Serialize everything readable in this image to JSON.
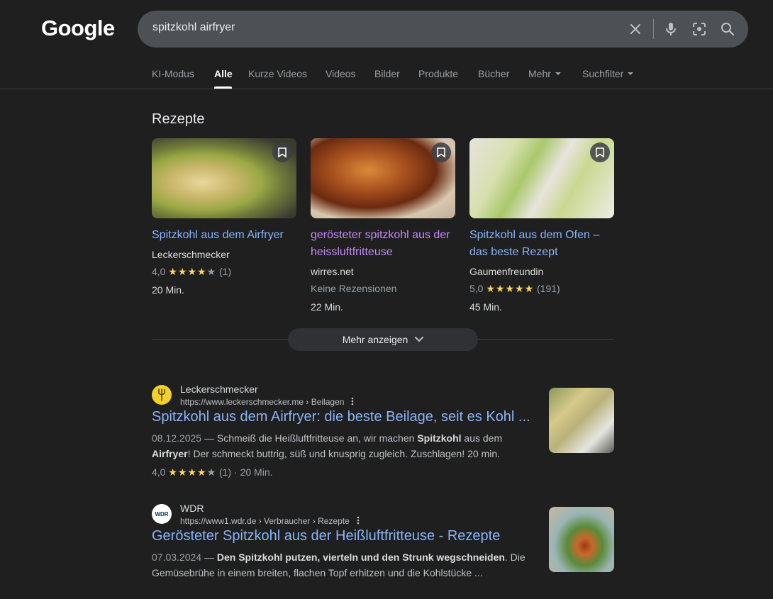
{
  "header": {
    "logo": "Google",
    "search_value": "spitzkohl airfryer"
  },
  "tabs": [
    {
      "label": "KI-Modus"
    },
    {
      "label": "Alle"
    },
    {
      "label": "Kurze Videos"
    },
    {
      "label": "Videos"
    },
    {
      "label": "Bilder"
    },
    {
      "label": "Produkte"
    },
    {
      "label": "Bücher"
    },
    {
      "label": "Mehr"
    },
    {
      "label": "Suchfilter"
    }
  ],
  "recipes": {
    "title": "Rezepte",
    "cards": [
      {
        "title": "Spitzkohl aus dem Airfryer",
        "source": "Leckerschmecker",
        "rating": "4,0",
        "stars": 4,
        "count": "(1)",
        "time": "20 Min."
      },
      {
        "title": "gerösteter spitzkohl aus der heissluftfritteuse",
        "source": "wirres.net",
        "no_reviews": "Keine Rezensionen",
        "time": "22 Min."
      },
      {
        "title": "Spitzkohl aus dem Ofen – das beste Rezept",
        "source": "Gaumenfreundin",
        "rating": "5,0",
        "stars": 5,
        "count": "(191)",
        "time": "45 Min."
      }
    ],
    "more_label": "Mehr anzeigen"
  },
  "results": [
    {
      "site": "Leckerschmecker",
      "url": "https://www.leckerschmecker.me › Beilagen",
      "title": "Spitzkohl aus dem Airfryer: die beste Beilage, seit es Kohl ...",
      "date": "08.12.2025",
      "snippet_parts": [
        "Schmeiß die Heißluftfritteuse an, wir machen ",
        "Spitzkohl",
        " aus dem ",
        "Airfryer",
        "! Der schmeckt buttrig, süß und knusprig zugleich. Zuschlagen! 20 min."
      ],
      "rating": "4,0",
      "count": "(1)",
      "time": "20 Min."
    },
    {
      "site": "WDR",
      "url": "https://www1.wdr.de › Verbraucher › Rezepte",
      "title": "Gerösteter Spitzkohl aus der Heißluftfritteuse - Rezepte",
      "date": "07.03.2024",
      "snippet_bold": "Den Spitzkohl putzen, vierteln und den Strunk wegschneiden",
      "snippet_rest": ". Die Gemüsebrühe in einem breiten, flachen Topf erhitzen und die Kohlstücke ...",
      "favicon_text": "WDR"
    }
  ],
  "colors": {
    "background": "#1f1f1f",
    "link": "#8ab4f8",
    "visited": "#c58af9",
    "star": "#fdd663"
  }
}
